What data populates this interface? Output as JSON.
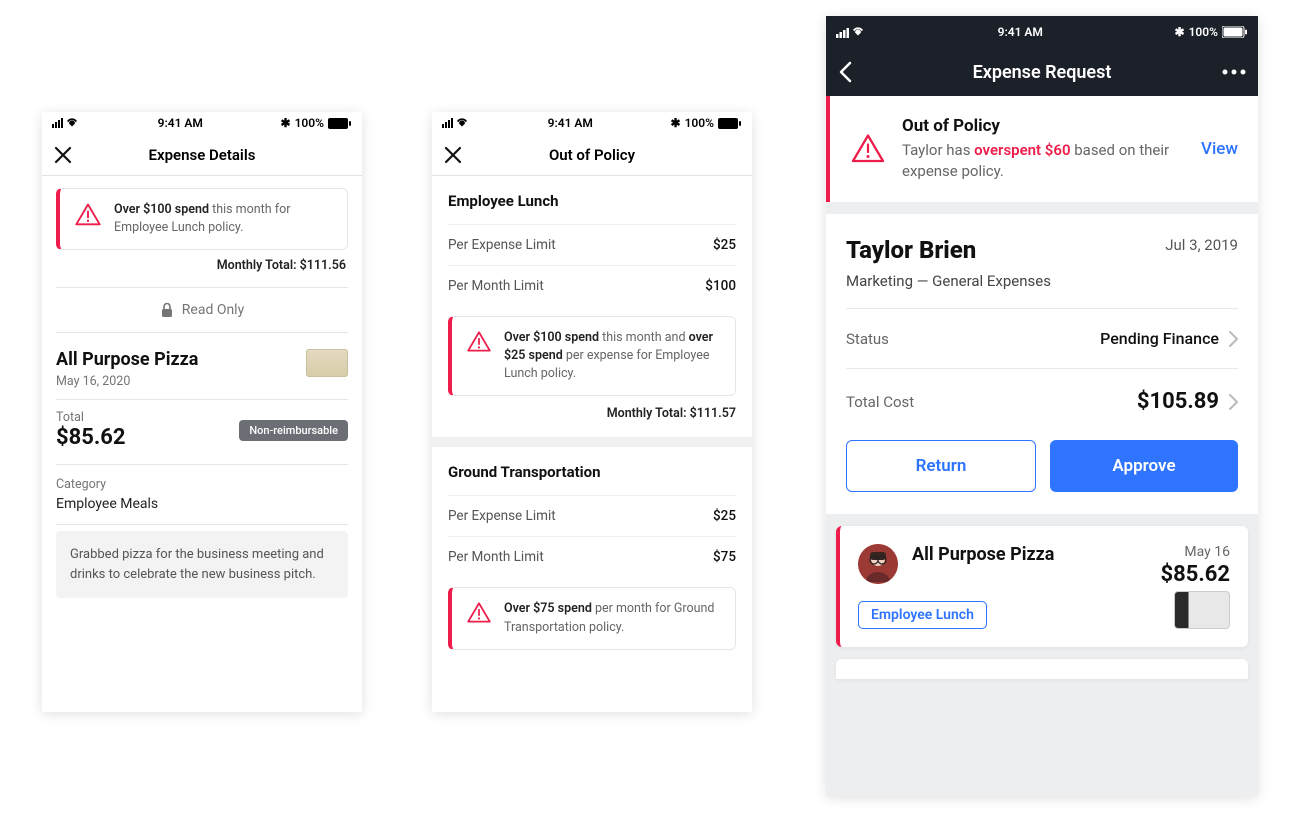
{
  "status": {
    "time": "9:41 AM",
    "battery": "100%"
  },
  "phone1": {
    "title": "Expense Details",
    "alert_prefix": "Over $100 spend",
    "alert_suffix": " this month for Employee Lunch policy.",
    "monthly_total_label": "Monthly Total: ",
    "monthly_total_value": "$111.56",
    "readonly": "Read Only",
    "merchant": "All Purpose Pizza",
    "merchant_date": "May 16, 2020",
    "total_label": "Total",
    "total_value": "$85.62",
    "badge": "Non-reimbursable",
    "category_label": "Category",
    "category_value": "Employee Meals",
    "note": "Grabbed pizza for the business meeting and  drinks to celebrate the new business pitch."
  },
  "phone2": {
    "title": "Out of Policy",
    "sec1": {
      "title": "Employee Lunch",
      "per_expense_label": "Per Expense Limit",
      "per_expense_value": "$25",
      "per_month_label": "Per Month Limit",
      "per_month_value": "$100",
      "alert_p1": "Over $100 spend",
      "alert_p2": " this month and ",
      "alert_p3": "over $25 spend",
      "alert_p4": " per expense for Employee Lunch policy.",
      "monthly_total_label": "Monthly Total: ",
      "monthly_total_value": "$111.57"
    },
    "sec2": {
      "title": "Ground Transportation",
      "per_expense_label": "Per Expense Limit",
      "per_expense_value": "$25",
      "per_month_label": "Per Month Limit",
      "per_month_value": "$75",
      "alert_p1": "Over $75 spend",
      "alert_p2": " per month for Ground Transportation policy."
    }
  },
  "phone3": {
    "title": "Expense Request",
    "alert_title": "Out of Policy",
    "alert_pre": "Taylor has ",
    "alert_red": "overspent $60",
    "alert_post": " based on their expense policy.",
    "view": "View",
    "name": "Taylor Brien",
    "date": "Jul 3, 2019",
    "subtitle": "Marketing — General Expenses",
    "status_label": "Status",
    "status_value": "Pending Finance",
    "total_label": "Total Cost",
    "total_value": "$105.89",
    "return_btn": "Return",
    "approve_btn": "Approve",
    "expense": {
      "merchant": "All Purpose Pizza",
      "date": "May 16",
      "amount": "$85.62",
      "tag": "Employee Lunch"
    }
  }
}
